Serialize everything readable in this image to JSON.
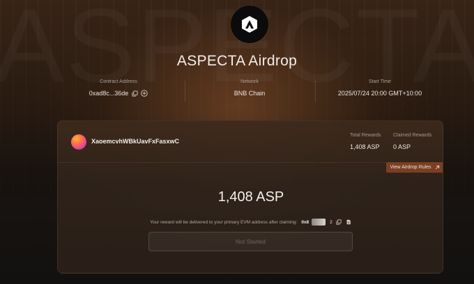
{
  "watermark": "ASPECTA",
  "page_title": "ASPECTA Airdrop",
  "info": {
    "contract": {
      "label": "Contract Address",
      "value": "0xad8c...36de"
    },
    "network": {
      "label": "Network",
      "value": "BNB Chain"
    },
    "start": {
      "label": "Start Time",
      "value": "2025/07/24 20:00 GMT+10:00"
    }
  },
  "card": {
    "username": "XaoemcvhWBkUavFxFasxwC",
    "total_rewards": {
      "label": "Total Rewards",
      "value": "1,408 ASP"
    },
    "claimed_rewards": {
      "label": "Claimed Rewards",
      "value": "0 ASP"
    },
    "rules_button": "View Airdrop Rules",
    "amount": "1,408 ASP",
    "notice": "Your reward will be delivered to your primary EVM address after claiming:",
    "address_start": "0x8",
    "address_end": "2",
    "status_button": "Not Started"
  },
  "colors": {
    "accent": "#7a3f22",
    "background": "#121110"
  },
  "icons": [
    "aspecta-logo-icon",
    "copy-icon",
    "add-icon",
    "arrow-up-right-icon",
    "copy-icon",
    "document-icon"
  ]
}
